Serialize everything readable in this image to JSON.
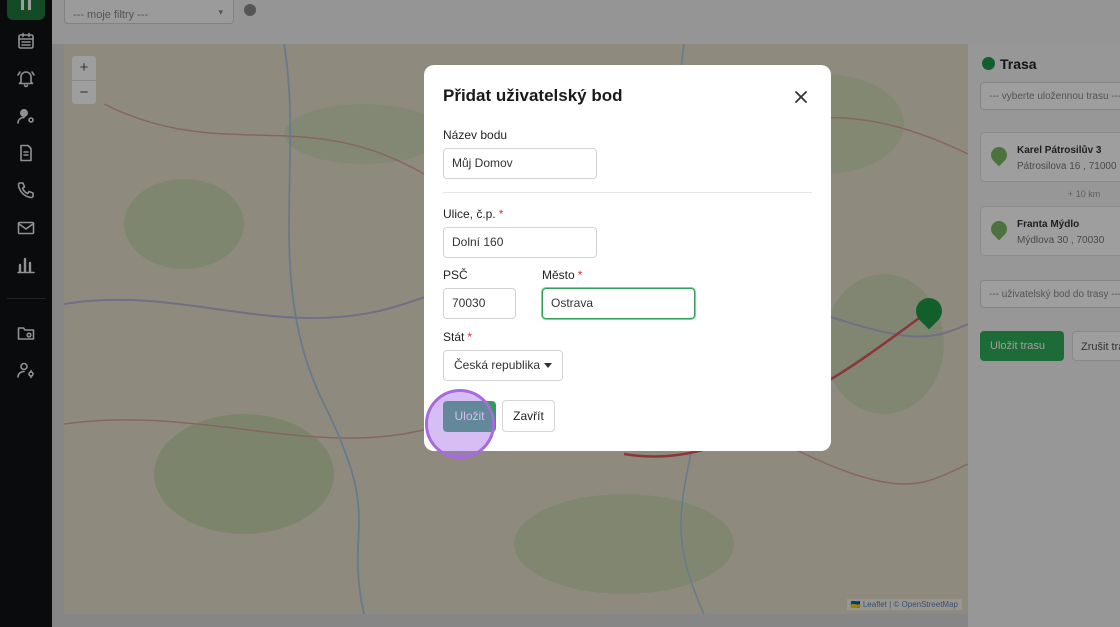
{
  "topbar": {
    "filter_placeholder": "--- moje filtry ---",
    "filter_arrow": "▾"
  },
  "sidebar": {
    "items": [
      {
        "icon": "calendar-icon"
      },
      {
        "icon": "bell-icon"
      },
      {
        "icon": "user-settings-icon"
      },
      {
        "icon": "document-icon"
      },
      {
        "icon": "phone-icon"
      },
      {
        "icon": "mail-icon"
      },
      {
        "icon": "bar-chart-icon"
      },
      {
        "icon": "folder-settings-icon"
      },
      {
        "icon": "user-cog-icon"
      }
    ]
  },
  "map": {
    "zoom_in": "+",
    "zoom_out": "−",
    "attribution": "🇺🇦 Leaflet | © OpenStreetMap"
  },
  "route_panel": {
    "title": "Trasa",
    "select_placeholder": "--- vyberte uložennou trasu ---",
    "stops": [
      {
        "name": "Karel Pátrosilův 3",
        "address": "Pátrosilova 16 , 71000"
      },
      {
        "name": "Franta Mýdlo",
        "address": "Mýdlova 30 , 70030"
      }
    ],
    "separator": "+ 10 km",
    "user_point_placeholder": "--- uživatelský bod do trasy ---",
    "save_label": "Uložit trasu",
    "cancel_label": "Zrušit trasu"
  },
  "modal": {
    "title": "Přidat uživatelský bod",
    "fields": {
      "name_label": "Název bodu",
      "name_value": "Můj Domov",
      "street_label": "Ulice, č.p.",
      "street_value": "Dolní 160",
      "zip_label": "PSČ",
      "zip_value": "70030",
      "city_label": "Město",
      "city_value": "Ostrava",
      "country_label": "Stát",
      "country_value": "Česká republika",
      "required_mark": "*"
    },
    "save_label": "Uložit",
    "close_label": "Zavřít"
  },
  "colors": {
    "primary": "#2f9e5a",
    "sidebar": "#111214",
    "required": "#d9342b",
    "click_indicator": "#a66bdc"
  }
}
